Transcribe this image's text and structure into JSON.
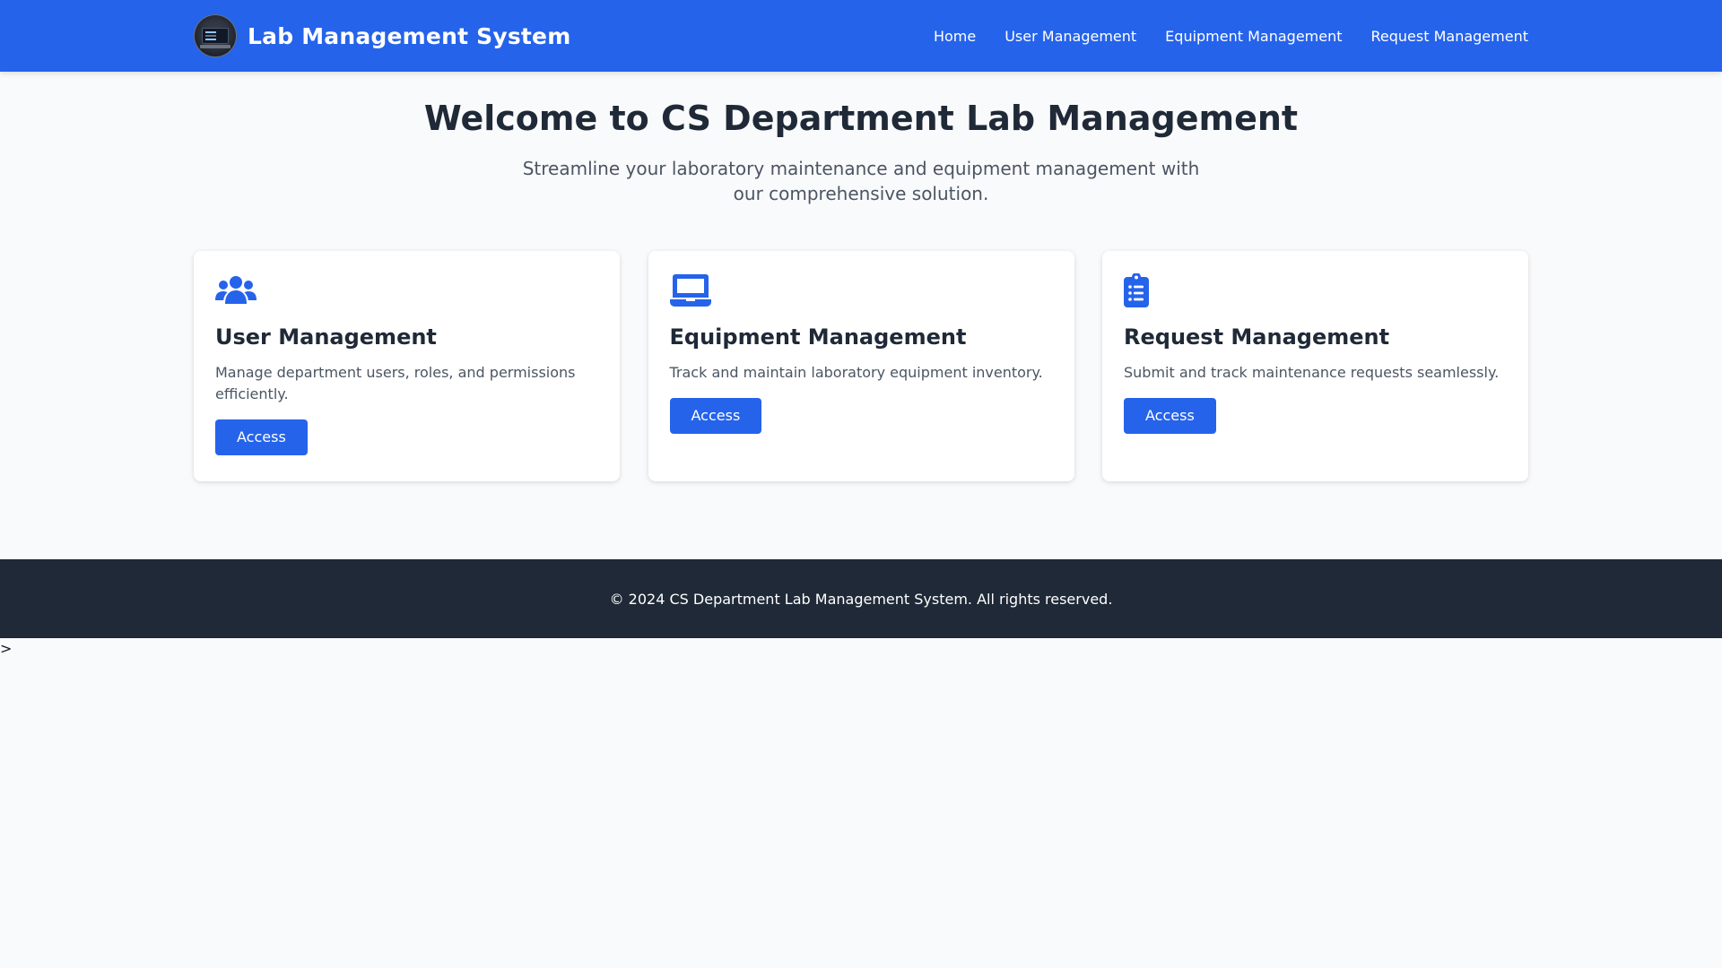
{
  "navbar": {
    "brand_title": "Lab Management System",
    "brand_logo": "lab-computer-logo",
    "links": [
      {
        "label": "Home"
      },
      {
        "label": "User Management"
      },
      {
        "label": "Equipment Management"
      },
      {
        "label": "Request Management"
      }
    ]
  },
  "hero": {
    "title": "Welcome to CS Department Lab Management",
    "subtitle": "Streamline your laboratory maintenance and equipment management with our comprehensive solution."
  },
  "cards": [
    {
      "icon": "users-icon",
      "title": "User Management",
      "description": "Manage department users, roles, and permissions efficiently.",
      "button_label": "Access"
    },
    {
      "icon": "laptop-icon",
      "title": "Equipment Management",
      "description": "Track and maintain laboratory equipment inventory.",
      "button_label": "Access"
    },
    {
      "icon": "clipboard-list-icon",
      "title": "Request Management",
      "description": "Submit and track maintenance requests seamlessly.",
      "button_label": "Access"
    }
  ],
  "footer": {
    "text": "© 2024 CS Department Lab Management System. All rights reserved."
  },
  "stray_text": ">",
  "colors": {
    "primary": "#2563eb",
    "footer_bg": "#1f2937",
    "page_bg": "#f9fafb",
    "heading": "#1f2937",
    "body_text": "#4b5563"
  }
}
